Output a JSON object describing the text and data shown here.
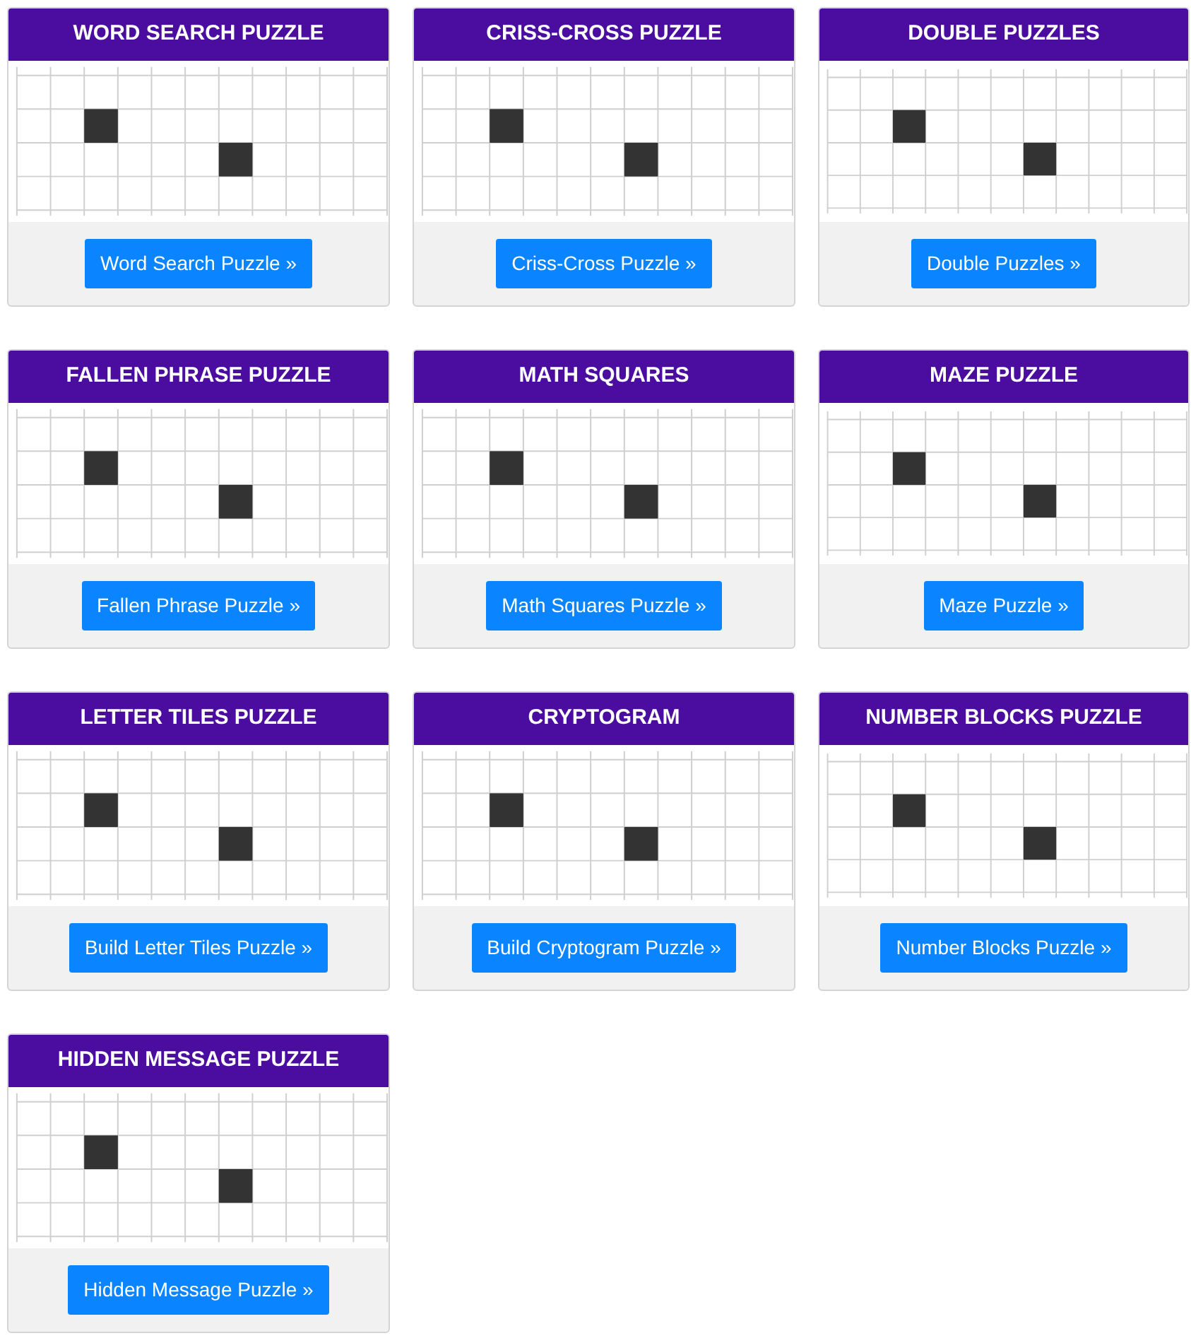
{
  "cards": [
    {
      "title": "WORD SEARCH PUZZLE",
      "button": "Word Search Puzzle »"
    },
    {
      "title": "CRISS-CROSS PUZZLE",
      "button": "Criss-Cross Puzzle »"
    },
    {
      "title": "DOUBLE PUZZLES",
      "button": "Double Puzzles »"
    },
    {
      "title": "FALLEN PHRASE PUZZLE",
      "button": "Fallen Phrase Puzzle »"
    },
    {
      "title": "MATH SQUARES",
      "button": "Math Squares Puzzle »"
    },
    {
      "title": "MAZE PUZZLE",
      "button": "Maze Puzzle »"
    },
    {
      "title": "LETTER TILES PUZZLE",
      "button": "Build Letter Tiles Puzzle »"
    },
    {
      "title": "CRYPTOGRAM",
      "button": "Build Cryptogram Puzzle »"
    },
    {
      "title": "NUMBER BLOCKS PUZZLE",
      "button": "Number Blocks Puzzle »"
    },
    {
      "title": "HIDDEN MESSAGE PUZZLE",
      "button": "Hidden Message Puzzle »"
    }
  ]
}
